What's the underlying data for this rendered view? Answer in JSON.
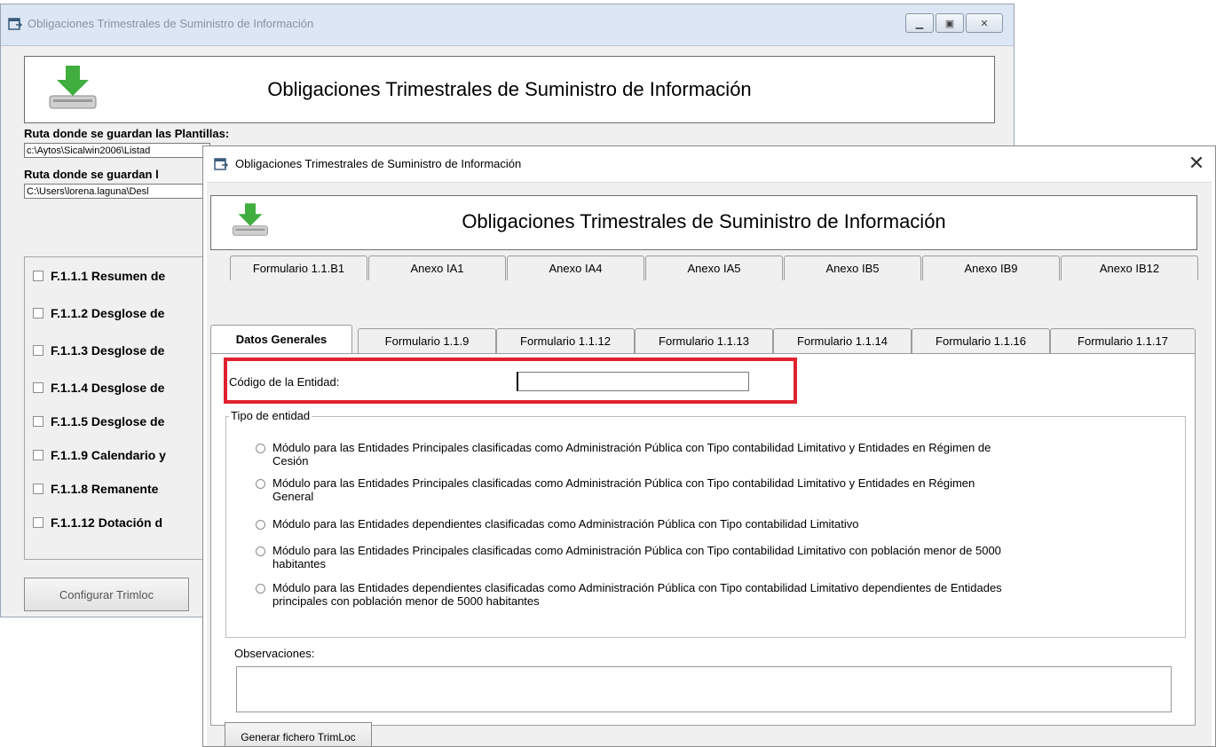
{
  "back_window": {
    "title": "Obligaciones Trimestrales de Suministro de Información",
    "header_title": "Obligaciones Trimestrales de Suministro de Información",
    "templates_label": "Ruta donde se guardan las Plantillas:",
    "templates_path": "c:\\Aytos\\Sicalwin2006\\Listad",
    "second_label": "Ruta donde se guardan l",
    "second_path": "C:\\Users\\lorena.laguna\\Desl",
    "checks": [
      "F.1.1.1 Resumen de",
      "F.1.1.2 Desglose de",
      "F.1.1.3 Desglose de",
      "F.1.1.4 Desglose de",
      "F.1.1.5 Desglose de",
      "F.1.1.9 Calendario y",
      "F.1.1.8 Remanente",
      "F.1.1.12 Dotación d"
    ],
    "configure_button": "Configurar Trimloc"
  },
  "front_window": {
    "title": "Obligaciones Trimestrales de Suministro de Información",
    "header_title": "Obligaciones Trimestrales de Suministro de Información",
    "tabs_row1": [
      "Formulario 1.1.B1",
      "Anexo IA1",
      "Anexo IA4",
      "Anexo IA5",
      "Anexo IB5",
      "Anexo IB9",
      "Anexo IB12"
    ],
    "tabs_row2": [
      "Datos Generales",
      "Formulario 1.1.9",
      "Formulario 1.1.12",
      "Formulario 1.1.13",
      "Formulario 1.1.14",
      "Formulario 1.1.16",
      "Formulario 1.1.17"
    ],
    "active_tab": "Datos Generales",
    "entity_code_label": "Código de la Entidad:",
    "entity_code_value": "",
    "entity_type_legend": "Tipo de entidad",
    "entity_types": [
      [
        "Módulo para las Entidades Principales clasificadas como Administración Pública con Tipo contabilidad Limitativo y Entidades en Régimen de",
        "Cesión"
      ],
      [
        "Módulo para las Entidades Principales clasificadas como Administración Pública con Tipo contabilidad Limitativo y Entidades en Régimen",
        "General"
      ],
      [
        "Módulo para las Entidades dependientes clasificadas como Administración Pública con Tipo contabilidad Limitativo"
      ],
      [
        "Módulo para las Entidades Principales clasificadas como Administración Pública con Tipo contabilidad Limitativo con población menor de 5000",
        "habitantes"
      ],
      [
        "Módulo para las Entidades dependientes clasificadas como Administración Pública con Tipo contabilidad Limitativo dependientes de Entidades",
        "principales con población menor de 5000 habitantes"
      ]
    ],
    "observations_label": "Observaciones:",
    "observations_value": "",
    "generate_button": "Generar fichero TrimLoc"
  },
  "colors": {
    "highlight": "#e0212f",
    "title_bar_back": "#dce6f4",
    "window_bg": "#f0f0f0"
  }
}
